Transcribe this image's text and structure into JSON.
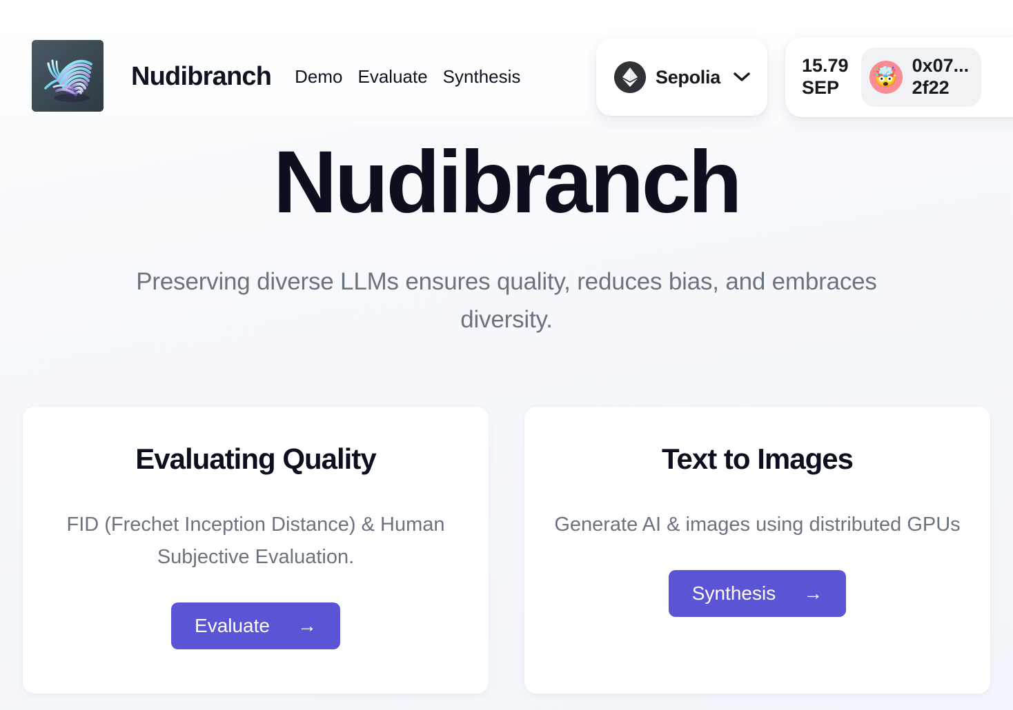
{
  "header": {
    "logo_alt": "nudibranch-logo",
    "brand": "Nudibranch",
    "nav": [
      {
        "label": "Demo",
        "name": "nav-demo"
      },
      {
        "label": "Evaluate",
        "name": "nav-evaluate"
      },
      {
        "label": "Synthesis",
        "name": "nav-synthesis"
      }
    ],
    "network": {
      "icon": "ethereum-icon",
      "name": "Sepolia",
      "chevron": "chevron-down-icon"
    },
    "wallet": {
      "balance_amount": "15.79",
      "balance_symbol": "SEP",
      "avatar_emoji": "🤯",
      "address_line1": "0x07...",
      "address_line2": "2f22"
    }
  },
  "hero": {
    "title": "Nudibranch",
    "subtitle": "Preserving diverse LLMs ensures quality, reduces bias, and embraces diversity."
  },
  "cards": [
    {
      "title": "Evaluating Quality",
      "description": "FID (Frechet Inception Distance) & Human Subjective Evaluation.",
      "button_label": "Evaluate",
      "button_arrow": "→"
    },
    {
      "title": "Text to Images",
      "description": "Generate AI & images using distributed GPUs",
      "button_label": "Synthesis",
      "button_arrow": "→"
    }
  ],
  "colors": {
    "accent": "#5b55d6",
    "heading": "#0c0f1d",
    "muted_text": "#6b7280",
    "avatar_bg": "#f98b95",
    "page_bg": "#f5f8fc"
  }
}
